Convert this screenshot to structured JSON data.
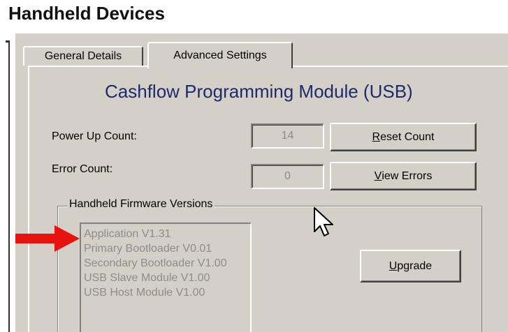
{
  "page": {
    "title": "Handheld Devices"
  },
  "tabs": [
    {
      "label": "General Details",
      "active": false
    },
    {
      "label": "Advanced Settings",
      "active": true
    }
  ],
  "module": {
    "title": "Cashflow Programming Module (USB)"
  },
  "power_up": {
    "label": "Power Up Count:",
    "value": "14"
  },
  "error": {
    "label": "Error Count:",
    "value": "0"
  },
  "buttons": {
    "reset": {
      "mnemonic": "R",
      "rest": "eset Count"
    },
    "view_errors": {
      "mnemonic": "V",
      "rest": "iew Errors"
    },
    "upgrade": {
      "mnemonic": "U",
      "rest": "pgrade"
    }
  },
  "firmware": {
    "group_label": "Handheld Firmware Versions",
    "versions": [
      "Application V1.31",
      "Primary Bootloader V0.01",
      "Secondary Bootloader V1.00",
      "USB Slave Module V1.00",
      "USB Host Module V1.00"
    ]
  },
  "icons": {
    "annotation": "red-arrow-icon",
    "pointer": "mouse-cursor-icon"
  },
  "colors": {
    "annotation_arrow": "#e8130f",
    "module_title": "#1c2a6e",
    "dialog_bg": "#d4d0c8"
  }
}
